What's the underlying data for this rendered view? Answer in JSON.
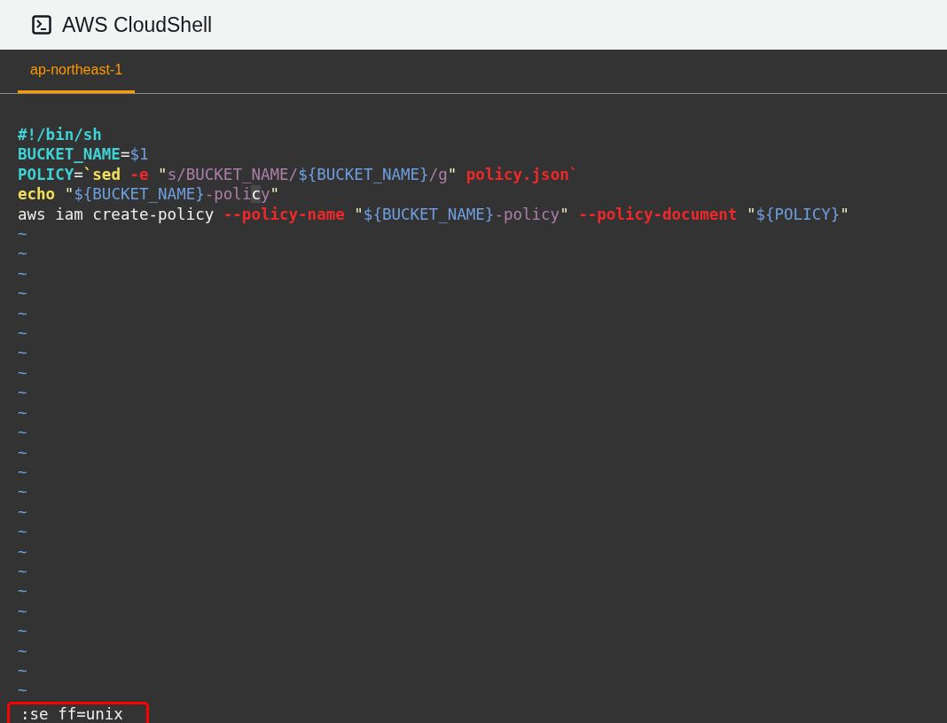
{
  "header": {
    "title": "AWS CloudShell"
  },
  "tabs": [
    {
      "label": "ap-northeast-1",
      "selected": true
    }
  ],
  "editor": {
    "lines": [
      [
        {
          "text": "#!/bin/sh",
          "kind": "comment"
        }
      ],
      [
        {
          "text": "BUCKET_NAME",
          "kind": "variable"
        },
        {
          "text": "=",
          "kind": "plain"
        },
        {
          "text": "$1",
          "kind": "special"
        }
      ],
      [
        {
          "text": "POLICY",
          "kind": "variable"
        },
        {
          "text": "=",
          "kind": "plain"
        },
        {
          "text": "`",
          "kind": "keyword"
        },
        {
          "text": "sed ",
          "kind": "keyword"
        },
        {
          "text": "-e ",
          "kind": "flag"
        },
        {
          "text": "\"",
          "kind": "quote"
        },
        {
          "text": "s/BUCKET_NAME/",
          "kind": "string"
        },
        {
          "text": "${BUCKET_NAME}",
          "kind": "special"
        },
        {
          "text": "/g",
          "kind": "string"
        },
        {
          "text": "\"",
          "kind": "quote"
        },
        {
          "text": " policy.json`",
          "kind": "flag"
        }
      ],
      [
        {
          "text": "echo ",
          "kind": "keyword"
        },
        {
          "text": "\"",
          "kind": "quote"
        },
        {
          "text": "${BUCKET_NAME}",
          "kind": "special"
        },
        {
          "text": "-poli",
          "kind": "string"
        },
        {
          "text": "c",
          "kind": "cursor"
        },
        {
          "text": "y",
          "kind": "string"
        },
        {
          "text": "\"",
          "kind": "quote"
        }
      ],
      [
        {
          "text": "aws iam create-policy ",
          "kind": "plain"
        },
        {
          "text": "--policy-name ",
          "kind": "flag"
        },
        {
          "text": "\"",
          "kind": "quote"
        },
        {
          "text": "${BUCKET_NAME}",
          "kind": "special"
        },
        {
          "text": "-policy",
          "kind": "string"
        },
        {
          "text": "\" ",
          "kind": "quote"
        },
        {
          "text": "--policy-document ",
          "kind": "flag"
        },
        {
          "text": "\"",
          "kind": "quote"
        },
        {
          "text": "${POLICY}",
          "kind": "special"
        },
        {
          "text": "\"",
          "kind": "quote"
        }
      ]
    ],
    "empty_line_markers": [
      "~",
      "~",
      "~",
      "~",
      "~",
      "~",
      "~",
      "~",
      "~",
      "~",
      "~",
      "~",
      "~",
      "~",
      "~",
      "~",
      "~",
      "~",
      "~",
      "~",
      "~",
      "~",
      "~",
      "~"
    ]
  },
  "command_line": {
    "text": ":se ff=unix",
    "highlighted": true
  }
}
